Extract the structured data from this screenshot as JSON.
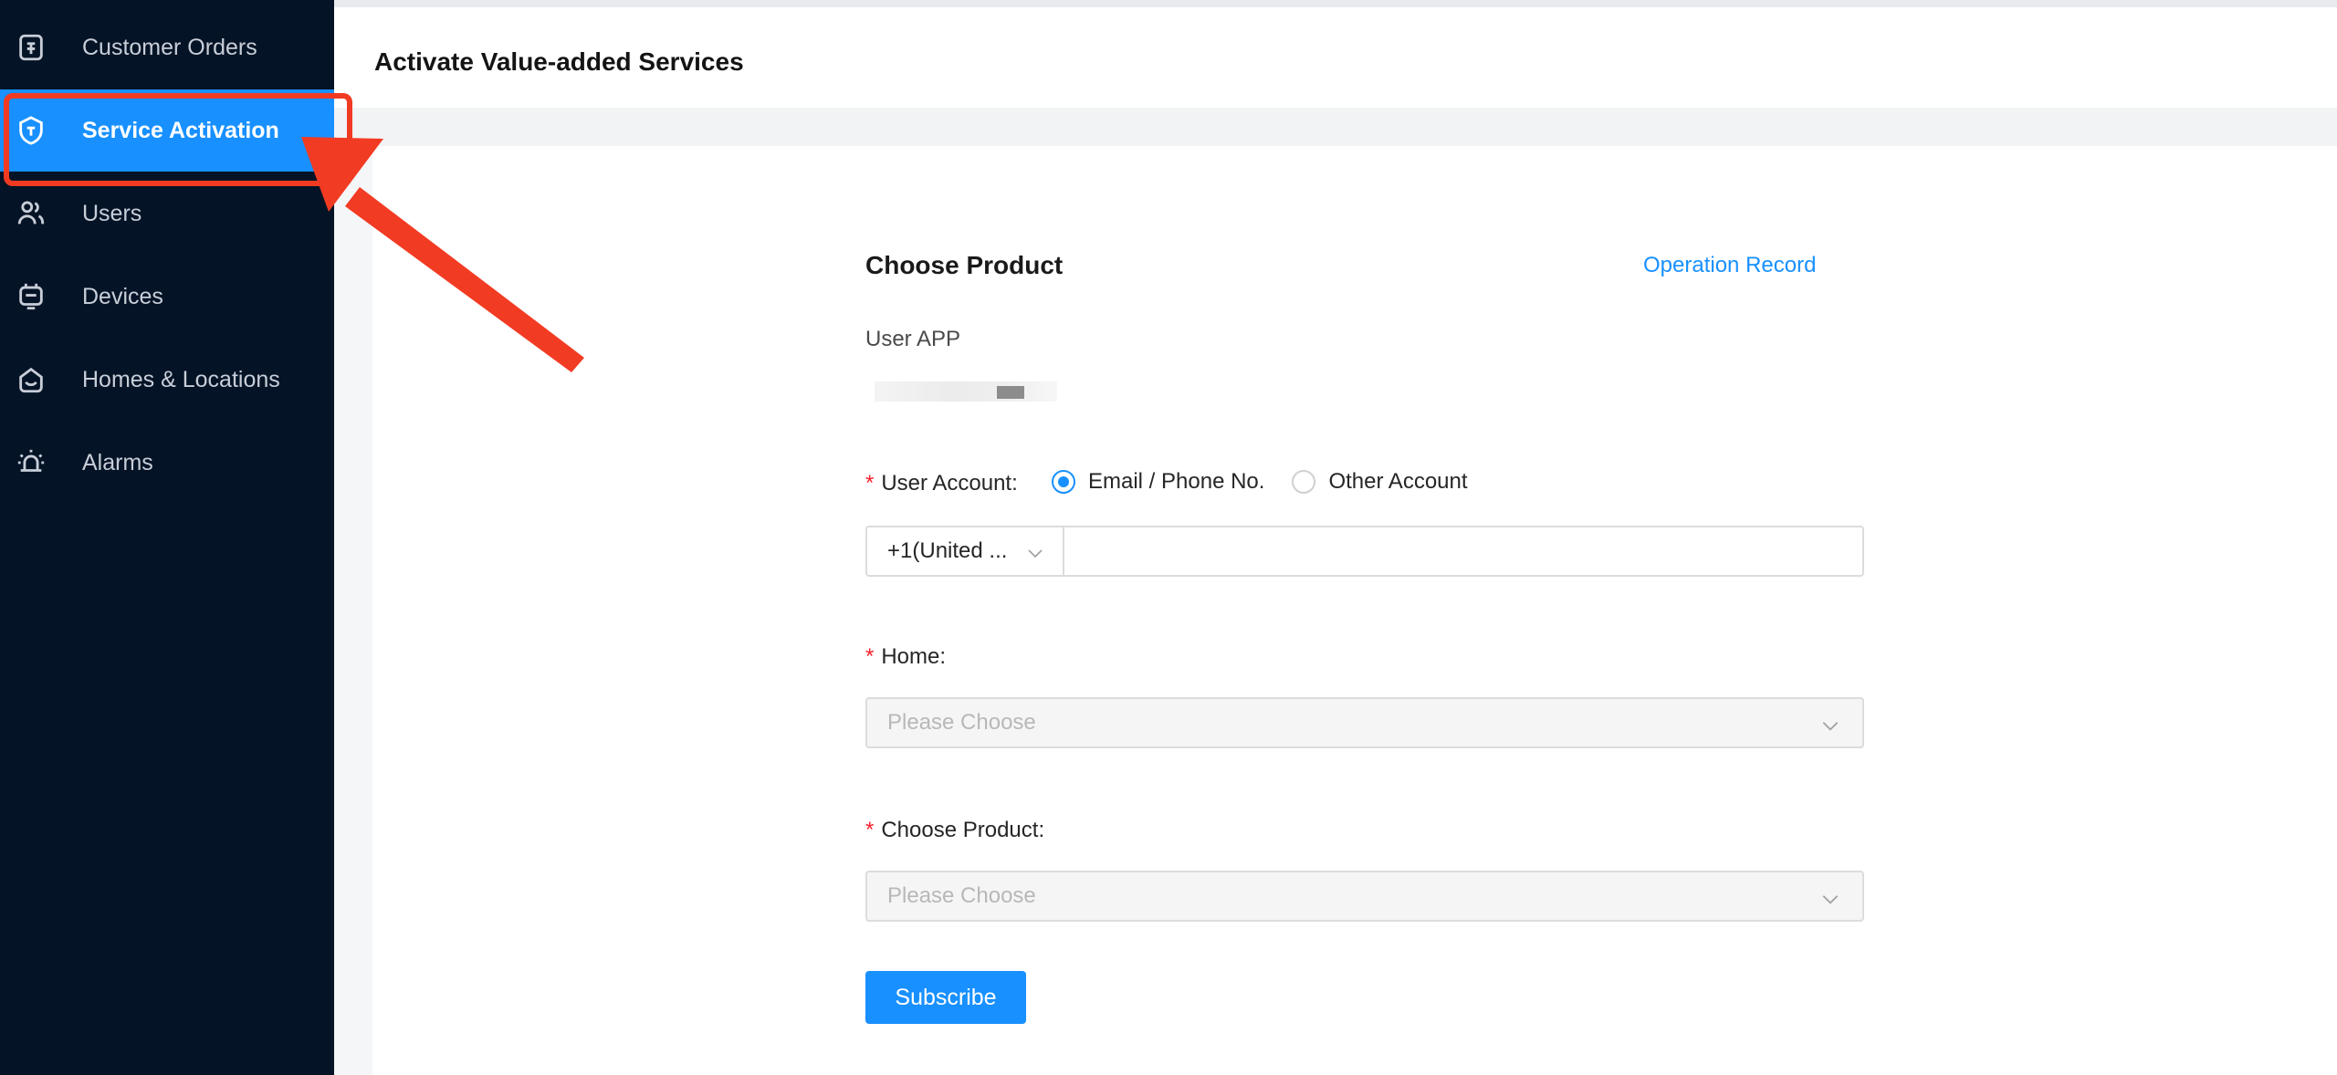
{
  "colors": {
    "sidebar_bg": "#041326",
    "accent": "#1890ff",
    "highlight_red": "#f03a22",
    "required_star": "#f5222d"
  },
  "sidebar": {
    "items": [
      {
        "label": "Customer Orders",
        "icon": "clipboard-icon",
        "active": false
      },
      {
        "label": "Service Activation",
        "icon": "service-badge-icon",
        "active": true
      },
      {
        "label": "Users",
        "icon": "users-icon",
        "active": false
      },
      {
        "label": "Devices",
        "icon": "device-icon",
        "active": false
      },
      {
        "label": "Homes & Locations",
        "icon": "home-icon",
        "active": false
      },
      {
        "label": "Alarms",
        "icon": "alarm-icon",
        "active": false
      }
    ]
  },
  "header": {
    "title": "Activate Value-added Services"
  },
  "form": {
    "section_title": "Choose Product",
    "operation_record": "Operation Record",
    "app_label": "User APP",
    "user_account": {
      "required": "*",
      "label": "User Account:",
      "options": [
        {
          "label": "Email / Phone No.",
          "selected": true
        },
        {
          "label": "Other Account",
          "selected": false
        }
      ],
      "country_code": "+1(United ...",
      "phone_value": ""
    },
    "home": {
      "required": "*",
      "label": "Home:",
      "placeholder": "Please Choose"
    },
    "product": {
      "required": "*",
      "label": "Choose Product:",
      "placeholder": "Please Choose"
    },
    "subscribe_label": "Subscribe"
  }
}
